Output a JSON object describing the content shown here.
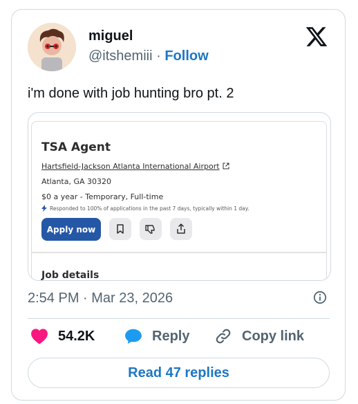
{
  "author": {
    "name": "miguel",
    "handle": "@itshemiii",
    "separator": "·",
    "follow_label": "Follow"
  },
  "tweet": {
    "text": "i'm done with job hunting bro pt. 2"
  },
  "job_card": {
    "title": "TSA Agent",
    "employer": "Hartsfield-Jackson Atlanta International Airport",
    "location": "Atlanta, GA 30320",
    "salary": "$0 a year",
    "job_type": "- Temporary, Full-time",
    "response_note": "Responded to 100% of applications in the past 7 days, typically within 1 day.",
    "apply_label": "Apply now",
    "details_heading": "Job details"
  },
  "meta": {
    "timestamp": "2:54 PM · Mar 23, 2026"
  },
  "actions": {
    "likes": "54.2K",
    "reply_label": "Reply",
    "copy_link_label": "Copy link"
  },
  "read_replies_label": "Read 47 replies",
  "colors": {
    "like_red": "#f91880",
    "reply_blue": "#1d9bf0",
    "follow_blue": "#1d77c4",
    "apply_blue": "#2557a7",
    "muted": "#536471"
  }
}
